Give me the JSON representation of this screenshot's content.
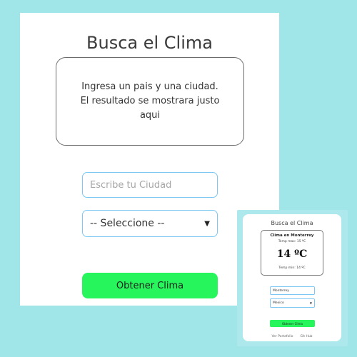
{
  "main": {
    "title": "Busca el Clima",
    "result_message": "Ingresa un pais y una ciudad. El resultado se mostrara justo aqui",
    "city_input": {
      "placeholder": "Escribe tu Ciudad",
      "value": ""
    },
    "country_select": {
      "selected": "-- Seleccione --"
    },
    "submit_label": "Obtener Clima"
  },
  "inset": {
    "title": "Busca el Clima",
    "result": {
      "city_heading": "Clima en Monterrey",
      "temp_max": "Temp max: 15 ºC",
      "temp_current": "14 ºC",
      "temp_min": "Temp min: 14 ºC"
    },
    "city_value": "Monterrey",
    "country_selected": "Mexico",
    "submit_label": "Obtener Clima",
    "links": [
      "Ver Portafolio",
      "Git Hub"
    ]
  },
  "colors": {
    "page_background": "#a0e6e9",
    "button_green": "#27f55c",
    "input_border": "#7cc7f4"
  }
}
